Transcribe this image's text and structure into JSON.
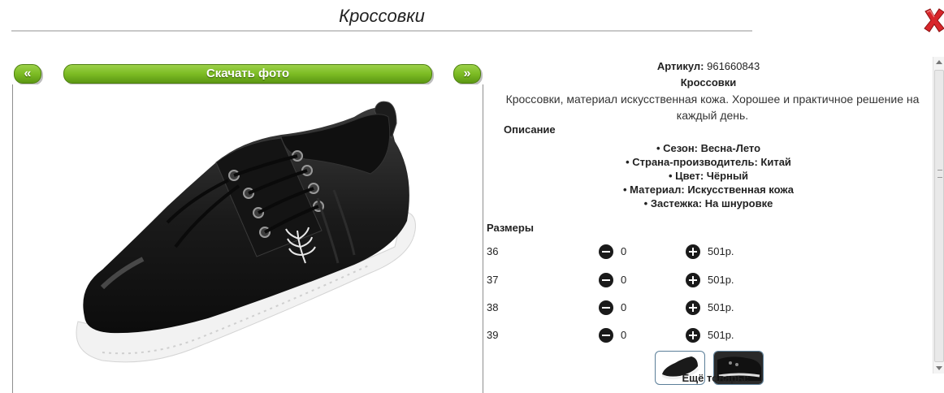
{
  "header": {
    "title": "Кроссовки",
    "close_icon": "close-x-icon"
  },
  "gallery": {
    "prev_label": "«",
    "download_label": "Скачать фото",
    "next_label": "»"
  },
  "product": {
    "article_label": "Артикул:",
    "article_value": "961660843",
    "name": "Кроссовки",
    "description": "Кроссовки, материал искусственная кожа. Хорошее и практичное решение на каждый день.",
    "description_heading": "Описание",
    "specs": [
      "Сезон: Весна-Лето",
      "Страна-производитель: Китай",
      "Цвет: Чёрный",
      "Материал: Искусственная кожа",
      "Застежка: На шнуровке"
    ]
  },
  "sizes": {
    "heading": "Размеры",
    "rows": [
      {
        "size": "36",
        "qty": "0",
        "price": "501р."
      },
      {
        "size": "37",
        "qty": "0",
        "price": "501р."
      },
      {
        "size": "38",
        "qty": "0",
        "price": "501р."
      },
      {
        "size": "39",
        "qty": "0",
        "price": "501р."
      }
    ]
  },
  "more_label": "Ещё товары:",
  "colors": {
    "accent_green": "#7cbc23",
    "close_red": "#d8262b"
  }
}
